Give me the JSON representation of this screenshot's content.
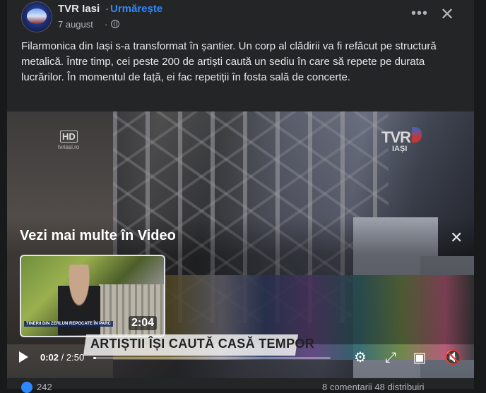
{
  "post": {
    "page_name": "TVR Iasi",
    "separator": "·",
    "follow_label": "Urmărește",
    "date": "7 august",
    "date_separator": "·",
    "more_icon": "more-options-icon",
    "close_icon": "close-icon",
    "caption": "Filarmonica din Iași s-a transformat în șantier. Un corp al clădirii va fi refăcut pe structură metalică. Între timp, cei peste 200 de artiști caută un sediu în care să repete pe durata lucrărilor. În momentul de față, ei fac repetiții în fosta sală de concerte."
  },
  "video": {
    "hd_badge": "HD",
    "hd_sub": "tvriasi.ro",
    "channel_logo": "TVR",
    "channel_city": "IAȘI",
    "lower_third": "ARTIȘTII ÎȘI CAUTĂ CASĂ TEMPOR",
    "more_videos_title": "Vezi mai multe în Video",
    "more_videos_close": "✕",
    "thumbnail_caption": "TINERII DIN ZERLUN REPOCATE ÎN PARC",
    "thumbnail_duration": "2:04",
    "current_time": "0:02",
    "time_separator": " / ",
    "total_time": "2:50",
    "progress_fraction": 0.012,
    "controls": [
      "play-icon",
      "settings-icon",
      "fullscreen-expand-icon",
      "picture-in-picture-icon",
      "mute-icon"
    ]
  },
  "footer": {
    "reaction_count": "242",
    "stats": "8 comentarii  48 distribuiri"
  },
  "colors": {
    "background": "#18191a",
    "card": "#242526",
    "accent": "#2d88ff",
    "text": "#e4e6eb",
    "secondary_text": "#b0b3b8"
  }
}
